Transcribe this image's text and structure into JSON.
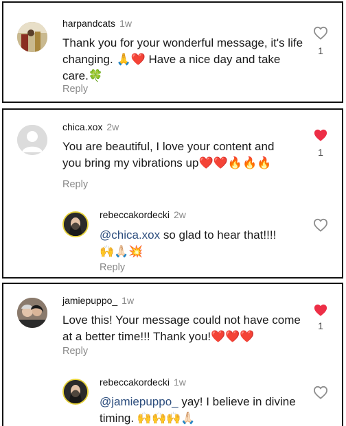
{
  "comments": [
    {
      "username": "harpandcats",
      "time": "1w",
      "text_before": "Thank you for your wonderful message, it's life changing. ",
      "emoji_1": "🙏❤️",
      "text_after": " Have a nice day and take care.",
      "emoji_2": "🍀",
      "reply_label": "Reply",
      "liked": false,
      "like_count": "1"
    },
    {
      "username": "chica.xox",
      "time": "2w",
      "text_before": "You are beautiful, I love your content and you bring my vibrations up",
      "emoji_1": "❤️❤️🔥🔥🔥",
      "reply_label": "Reply",
      "liked": true,
      "like_count": "1"
    },
    {
      "username": "rebeccakordecki",
      "time": "2w",
      "mention": "@chica.xox",
      "text": " so glad to hear that!!!!",
      "emoji": "🙌🙏🏻💥",
      "reply_label": "Reply",
      "liked": false
    },
    {
      "username": "jamiepuppo_",
      "time": "1w",
      "text": "Love this! Your message could not have come at a better time!!! Thank you!",
      "emoji": "❤️❤️❤️",
      "reply_label": "Reply",
      "liked": true,
      "like_count": "1"
    },
    {
      "username": "rebeccakordecki",
      "time": "1w",
      "mention": "@jamiepuppo_",
      "text": " yay!  I believe in divine timing. ",
      "emoji": "🙌🙌🙌🙏🏻",
      "liked": false
    }
  ],
  "colors": {
    "heart_liked": "#ed2e46",
    "mention": "#2d4e7e",
    "muted": "#888888"
  }
}
